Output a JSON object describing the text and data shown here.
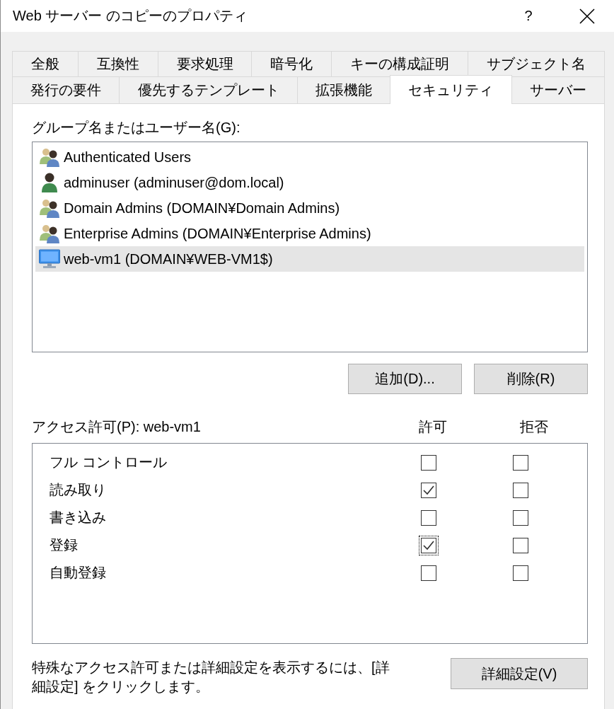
{
  "window": {
    "title": "Web サーバー のコピーのプロパティ",
    "help": "?"
  },
  "tab_rows": [
    {
      "tabs": [
        {
          "label": "全般",
          "selected": false
        },
        {
          "label": "互換性",
          "selected": false
        },
        {
          "label": "要求処理",
          "selected": false
        },
        {
          "label": "暗号化",
          "selected": false
        },
        {
          "label": "キーの構成証明",
          "selected": false
        },
        {
          "label": "サブジェクト名",
          "selected": false
        }
      ]
    },
    {
      "tabs": [
        {
          "label": "発行の要件",
          "selected": false
        },
        {
          "label": "優先するテンプレート",
          "selected": false
        },
        {
          "label": "拡張機能",
          "selected": false
        },
        {
          "label": "セキュリティ",
          "selected": true
        },
        {
          "label": "サーバー",
          "selected": false
        }
      ]
    }
  ],
  "principals": {
    "label": "グループ名またはユーザー名(G):",
    "items": [
      {
        "name": "Authenticated Users",
        "kind": "group",
        "selected": false
      },
      {
        "name": "adminuser (adminuser@dom.local)",
        "kind": "user",
        "selected": false
      },
      {
        "name": "Domain Admins (DOMAIN¥Domain Admins)",
        "kind": "group",
        "selected": false
      },
      {
        "name": "Enterprise Admins (DOMAIN¥Enterprise Admins)",
        "kind": "group",
        "selected": false
      },
      {
        "name": "web-vm1 (DOMAIN¥WEB-VM1$)",
        "kind": "computer",
        "selected": true
      }
    ]
  },
  "principal_buttons": [
    "追加(D)...",
    "削除(R)"
  ],
  "permissions": {
    "label": "アクセス許可(P): web-vm1",
    "columns": [
      "許可",
      "拒否"
    ],
    "rows": [
      {
        "name": "フル コントロール",
        "allow": {
          "checked": false,
          "focused": false
        },
        "deny": {
          "checked": false,
          "focused": false
        }
      },
      {
        "name": "読み取り",
        "allow": {
          "checked": true,
          "focused": false
        },
        "deny": {
          "checked": false,
          "focused": false
        }
      },
      {
        "name": "書き込み",
        "allow": {
          "checked": false,
          "focused": false
        },
        "deny": {
          "checked": false,
          "focused": false
        }
      },
      {
        "name": "登録",
        "allow": {
          "checked": true,
          "focused": true
        },
        "deny": {
          "checked": false,
          "focused": false
        }
      },
      {
        "name": "自動登録",
        "allow": {
          "checked": false,
          "focused": false
        },
        "deny": {
          "checked": false,
          "focused": false
        }
      }
    ]
  },
  "footer": {
    "note": "特殊なアクセス許可または詳細設定を表示するには、[詳細設定] をクリックします。",
    "button": "詳細設定(V)"
  }
}
